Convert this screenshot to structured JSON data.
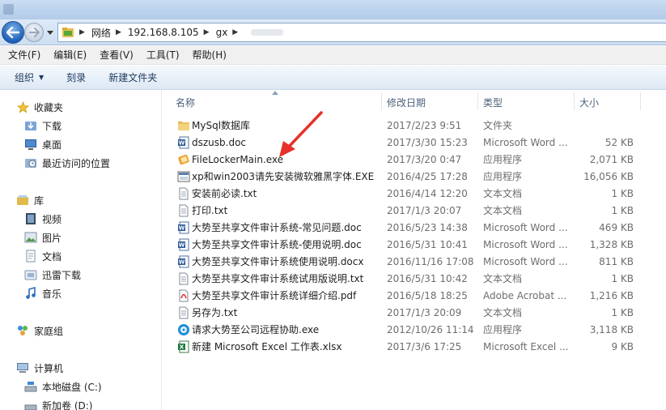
{
  "addressbar": {
    "crumbs": [
      "网络",
      "192.168.8.105",
      "gx"
    ]
  },
  "menu": [
    "文件(F)",
    "编辑(E)",
    "查看(V)",
    "工具(T)",
    "帮助(H)"
  ],
  "commands": {
    "organize": "组织",
    "burn": "刻录",
    "new_folder": "新建文件夹"
  },
  "navpane": {
    "favorites": {
      "label": "收藏夹",
      "items": [
        "下载",
        "桌面",
        "最近访问的位置"
      ]
    },
    "libraries": {
      "label": "库",
      "items": [
        "视频",
        "图片",
        "文档",
        "迅雷下载",
        "音乐"
      ]
    },
    "homegroup": "家庭组",
    "computer": {
      "label": "计算机",
      "items": [
        "本地磁盘 (C:)",
        "新加卷 (D:)"
      ]
    }
  },
  "columns": {
    "name": "名称",
    "date": "修改日期",
    "type": "类型",
    "size": "大小"
  },
  "files": [
    {
      "name": "MySql数据库",
      "date": "2017/2/23 9:51",
      "type": "文件夹",
      "size": "",
      "icon": "folder-icon"
    },
    {
      "name": "dszusb.doc",
      "date": "2017/3/30 15:23",
      "type": "Microsoft Word ...",
      "size": "52 KB",
      "icon": "word-doc-icon"
    },
    {
      "name": "FileLockerMain.exe",
      "date": "2017/3/20 0:47",
      "type": "应用程序",
      "size": "2,071 KB",
      "icon": "filelocker-app-icon"
    },
    {
      "name": "xp和win2003请先安装微软雅黑字体.EXE",
      "date": "2016/4/25 17:28",
      "type": "应用程序",
      "size": "16,056 KB",
      "icon": "font-installer-icon"
    },
    {
      "name": "安装前必读.txt",
      "date": "2016/4/14 12:20",
      "type": "文本文档",
      "size": "1 KB",
      "icon": "text-file-icon"
    },
    {
      "name": "打印.txt",
      "date": "2017/1/3 20:07",
      "type": "文本文档",
      "size": "1 KB",
      "icon": "text-file-icon"
    },
    {
      "name": "大势至共享文件审计系统-常见问题.doc",
      "date": "2016/5/23 14:38",
      "type": "Microsoft Word ...",
      "size": "469 KB",
      "icon": "word-doc-icon"
    },
    {
      "name": "大势至共享文件审计系统-使用说明.doc",
      "date": "2016/5/31 10:41",
      "type": "Microsoft Word ...",
      "size": "1,328 KB",
      "icon": "word-doc-icon"
    },
    {
      "name": "大势至共享文件审计系统使用说明.docx",
      "date": "2016/11/16 17:08",
      "type": "Microsoft Word ...",
      "size": "811 KB",
      "icon": "word-doc-icon"
    },
    {
      "name": "大势至共享文件审计系统试用版说明.txt",
      "date": "2016/5/31 10:42",
      "type": "文本文档",
      "size": "1 KB",
      "icon": "text-file-icon"
    },
    {
      "name": "大势至共享文件审计系统详细介绍.pdf",
      "date": "2016/5/18 18:25",
      "type": "Adobe Acrobat ...",
      "size": "1,216 KB",
      "icon": "pdf-file-icon"
    },
    {
      "name": "另存为.txt",
      "date": "2017/1/3 20:09",
      "type": "文本文档",
      "size": "1 KB",
      "icon": "text-file-icon"
    },
    {
      "name": "请求大势至公司远程协助.exe",
      "date": "2012/10/26 11:14",
      "type": "应用程序",
      "size": "3,118 KB",
      "icon": "remote-assist-app-icon"
    },
    {
      "name": "新建 Microsoft Excel 工作表.xlsx",
      "date": "2017/3/6 17:25",
      "type": "Microsoft Excel ...",
      "size": "9 KB",
      "icon": "excel-file-icon"
    }
  ],
  "colors": {
    "annotation_arrow": "#e8302a",
    "accent": "#1d5fb5"
  }
}
